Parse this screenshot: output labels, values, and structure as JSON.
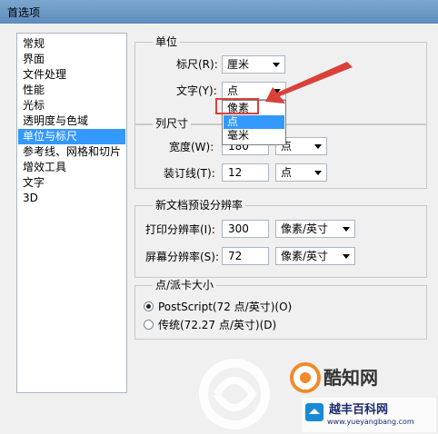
{
  "window": {
    "title": "首选项"
  },
  "nav": {
    "items": [
      "常规",
      "界面",
      "文件处理",
      "性能",
      "光标",
      "透明度与色域",
      "单位与标尺",
      "参考线、网格和切片",
      "增效工具",
      "文字",
      "3D"
    ],
    "selected_index": 6
  },
  "units": {
    "legend": "单位",
    "ruler_label": "标尺(R):",
    "ruler_value": "厘米",
    "type_label": "文字(Y):",
    "type_value": "点",
    "type_options": [
      "像素",
      "点",
      "毫米"
    ],
    "type_selected_option": "点"
  },
  "column": {
    "legend": "列尺寸",
    "width_label": "宽度(W):",
    "width_value": "180",
    "width_unit": "点",
    "gutter_label": "装订线(T):",
    "gutter_value": "12",
    "gutter_unit": "点"
  },
  "preset": {
    "legend": "新文档预设分辨率",
    "print_label": "打印分辨率(I):",
    "print_value": "300",
    "print_unit": "像素/英寸",
    "screen_label": "屏幕分辨率(S):",
    "screen_value": "72",
    "screen_unit": "像素/英寸"
  },
  "point": {
    "legend": "点/派卡大小",
    "postscript_label": "PostScript(72 点/英寸)(O)",
    "traditional_label": "传统(72.27 点/英寸)(D)",
    "selected": "postscript"
  },
  "watermark": {
    "brand": "酷知网",
    "site_name": "越丰百科网",
    "site_url": "www.yueyangbang.com"
  },
  "colors": {
    "highlight": "#d9413a",
    "selection": "#3399ff"
  }
}
